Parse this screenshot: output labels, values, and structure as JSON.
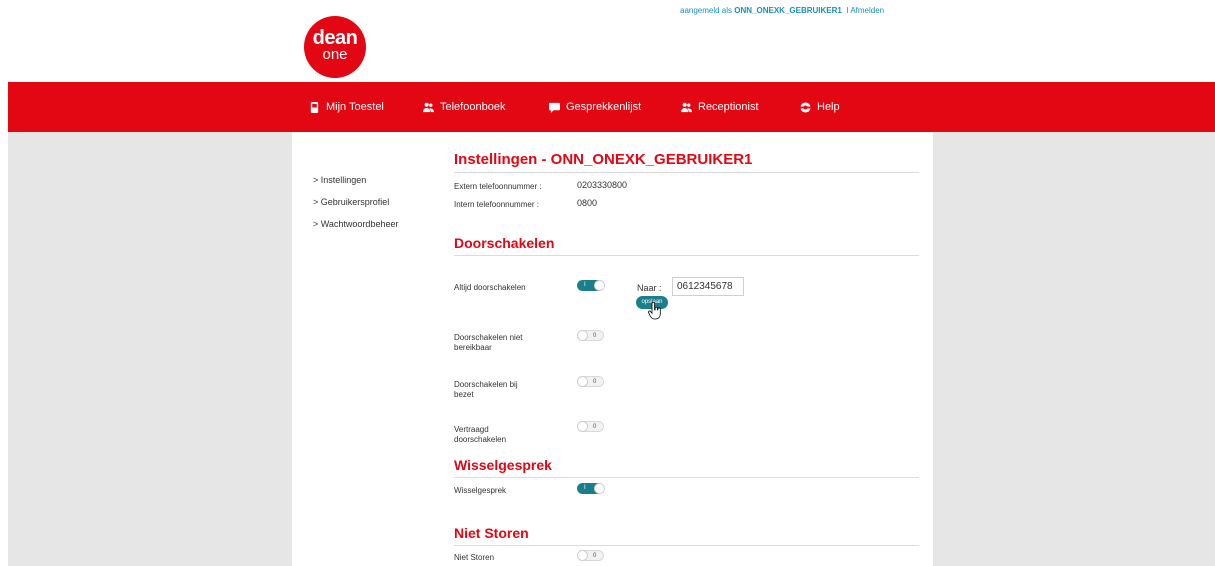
{
  "header": {
    "logo_line1": "dean",
    "logo_line2": "one",
    "logged_in_prefix": "aangemeld als",
    "username": "ONN_ONEXK_GEBRUIKER1",
    "separator": "I",
    "logout": "Afmelden"
  },
  "nav": [
    {
      "label": "Mijn Toestel",
      "icon": "phone-icon"
    },
    {
      "label": "Telefoonboek",
      "icon": "contacts-icon"
    },
    {
      "label": "Gesprekkenlijst",
      "icon": "chat-bubble-icon"
    },
    {
      "label": "Receptionist",
      "icon": "receptionist-icon"
    },
    {
      "label": "Help",
      "icon": "lifebuoy-icon"
    }
  ],
  "sidebar": [
    {
      "label": "> Instellingen"
    },
    {
      "label": "> Gebruikersprofiel"
    },
    {
      "label": "> Wachtwoordbeheer"
    }
  ],
  "settings": {
    "title": "Instellingen - ONN_ONEXK_GEBRUIKER1",
    "extern_label": "Extern telefoonnummer :",
    "extern_value": "0203330800",
    "intern_label": "Intern telefoonnummer :",
    "intern_value": "0800"
  },
  "doorschakelen": {
    "title": "Doorschakelen",
    "altijd_label": "Altijd doorschakelen",
    "altijd_state": "I",
    "naar_label": "Naar :",
    "naar_value": "0612345678",
    "save_label": "opslaan",
    "niet_bereikbaar_label": "Doorschakelen niet bereikbaar",
    "niet_bereikbaar_state": "0",
    "bij_bezet_label": "Doorschakelen bij bezet",
    "bij_bezet_state": "0",
    "vertraagd_label": "Vertraagd doorschakelen",
    "vertraagd_state": "0"
  },
  "wisselgesprek": {
    "title": "Wisselgesprek",
    "label": "Wisselgesprek",
    "state": "I"
  },
  "niet_storen": {
    "title": "Niet Storen",
    "label": "Niet Storen",
    "state": "0"
  },
  "colors": {
    "brand_red": "#e30613",
    "toggle_on": "#1a7e8c",
    "link_blue": "#1a8fb5"
  }
}
